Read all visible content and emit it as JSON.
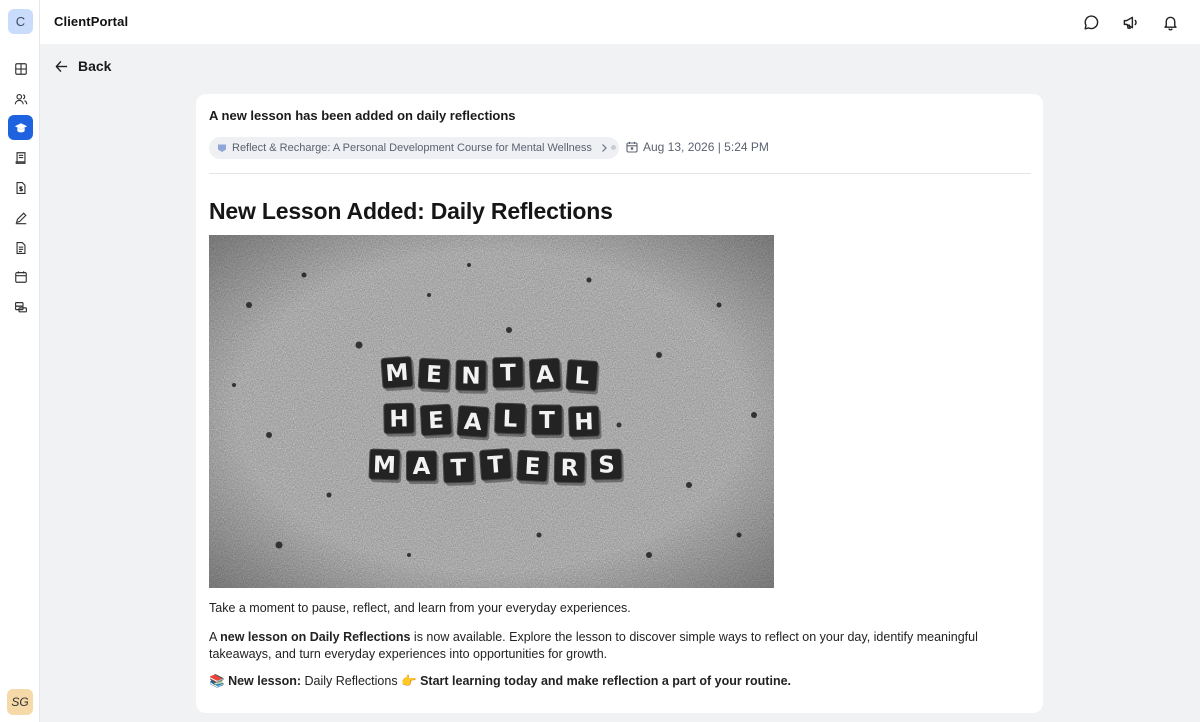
{
  "app": {
    "logo_letter": "C",
    "title": "ClientPortal",
    "user_initials": "SG"
  },
  "sidebar": {
    "items": [
      {
        "icon": "layout-icon"
      },
      {
        "icon": "users-icon"
      },
      {
        "icon": "graduation-cap-icon",
        "active": true
      },
      {
        "icon": "receipt-icon"
      },
      {
        "icon": "invoice-icon"
      },
      {
        "icon": "pen-icon"
      },
      {
        "icon": "document-icon"
      },
      {
        "icon": "calendar-icon"
      },
      {
        "icon": "stack-icon"
      }
    ]
  },
  "header": {
    "icons": [
      "chat-icon",
      "megaphone-icon",
      "bell-icon"
    ]
  },
  "back": {
    "label": "Back"
  },
  "notification": {
    "title": "A new lesson has been added on daily reflections",
    "course_chip": "Reflect & Recharge: A Personal Development Course for Mental Wellness",
    "datetime": "Aug 13, 2026 | 5:24 PM"
  },
  "post": {
    "title": "New Lesson Added: Daily Reflections",
    "image_text": [
      "MENTAL",
      "HEALTH",
      "MATTERS"
    ],
    "paragraph1": "Take a moment to pause, reflect, and learn from your everyday experiences.",
    "paragraph2": {
      "prefix": "A ",
      "bold": "new lesson on Daily Reflections",
      "suffix": " is now available. Explore the lesson to discover simple ways to reflect on your day, identify meaningful takeaways, and turn everyday experiences into opportunities for growth."
    },
    "paragraph3": {
      "emoji1": "📚",
      "label_bold": "New lesson:",
      "lesson_name": " Daily Reflections ",
      "emoji2": "👉",
      "cta_bold": " Start learning today and make reflection a part of your routine."
    }
  },
  "colors": {
    "accent": "#1f62e0",
    "page_bg": "#f1f2f4",
    "logo_bg": "#c9dcfb",
    "avatar_bg": "#f6d9a8"
  }
}
